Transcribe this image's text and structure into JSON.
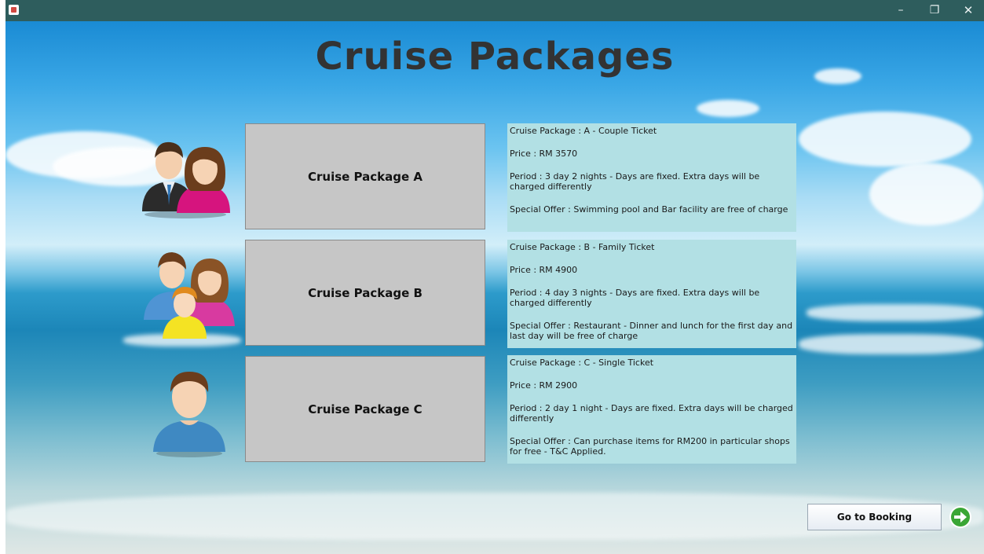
{
  "window": {
    "icon": "java-app-icon",
    "controls": {
      "minimize": "–",
      "restore": "❐",
      "close": "✕"
    }
  },
  "page": {
    "title": "Cruise Packages"
  },
  "packages": [
    {
      "button_label": "Cruise Package A",
      "icon": "couple-icon",
      "info": {
        "name": "Cruise Package : A - Couple Ticket",
        "price": "Price : RM 3570",
        "period": "Period : 3 day 2 nights - Days are fixed. Extra days will be charged differently",
        "offer": "Special Offer : Swimming pool and Bar facility are free of charge"
      }
    },
    {
      "button_label": "Cruise Package B",
      "icon": "family-icon",
      "info": {
        "name": "Cruise Package : B - Family Ticket",
        "price": "Price : RM 4900",
        "period": "Period : 4 day 3 nights - Days are fixed. Extra days will be charged differently",
        "offer": "Special Offer : Restaurant - Dinner and lunch for the first day and last day will be free of charge"
      }
    },
    {
      "button_label": "Cruise Package C",
      "icon": "single-person-icon",
      "info": {
        "name": "Cruise Package : C - Single Ticket",
        "price": "Price : RM 2900",
        "period": "Period : 2 day 1 night - Days are fixed. Extra days will be charged differently",
        "offer": "Special Offer : Can purchase items for RM200 in particular shops for free - T&C Applied."
      }
    }
  ],
  "footer": {
    "booking_label": "Go to Booking",
    "arrow_icon": "arrow-right-circle-icon"
  },
  "colors": {
    "titlebar": "#2e5d5d",
    "info_panel": "#b2e0e4",
    "package_button": "#c6c6c6",
    "arrow_green": "#3aa635"
  }
}
